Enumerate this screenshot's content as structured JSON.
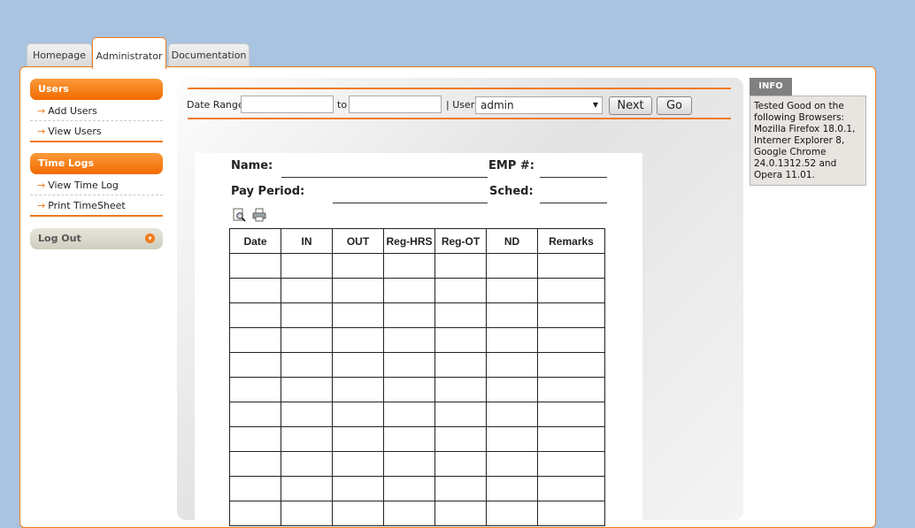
{
  "tabs": [
    {
      "label": "Homepage"
    },
    {
      "label": "Administrator"
    },
    {
      "label": "Documentation"
    }
  ],
  "sidebar": {
    "users_header": "Users",
    "users_items": [
      {
        "label": "Add Users"
      },
      {
        "label": "View Users"
      }
    ],
    "timelogs_header": "Time Logs",
    "timelogs_items": [
      {
        "label": "View Time Log"
      },
      {
        "label": "Print TimeSheet"
      }
    ],
    "logout_label": "Log Out"
  },
  "filter": {
    "date_range_label": "Date Range",
    "from_value": "",
    "to_label": "to",
    "to_value": "",
    "user_label": "| User",
    "user_selected": "admin",
    "next_label": "Next",
    "go_label": "Go"
  },
  "timesheet": {
    "name_label": "Name:",
    "emp_label": "EMP #:",
    "pay_period_label": "Pay Period:",
    "sched_label": "Sched:",
    "columns": [
      "Date",
      "IN",
      "OUT",
      "Reg-HRS",
      "Reg-OT",
      "ND",
      "Remarks"
    ],
    "empty_rows": 11
  },
  "info": {
    "tab_label": "INFO",
    "text": "Tested Good on the following Browsers: Mozilla Firefox 18.0.1, Interner Explorer 8, Google Chrome 24.0.1312.52 and Opera 11.01."
  },
  "icons": {
    "preview": "print-preview-icon",
    "print": "printer-icon",
    "logout": "chevron-down-icon"
  }
}
